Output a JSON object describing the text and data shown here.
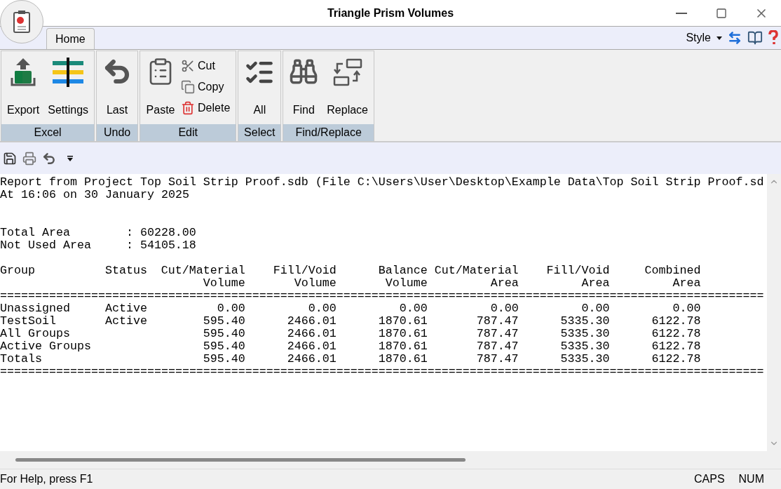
{
  "window": {
    "title": "Triangle Prism Volumes"
  },
  "tabs": [
    {
      "label": "Home",
      "selected": true
    }
  ],
  "style_menu": {
    "label": "Style"
  },
  "ribbon_groups": [
    {
      "label": "Excel",
      "items": [
        {
          "kind": "large",
          "label": "Export"
        },
        {
          "kind": "large",
          "label": "Settings"
        }
      ]
    },
    {
      "label": "Undo",
      "items": [
        {
          "kind": "large",
          "label": "Last"
        }
      ]
    },
    {
      "label": "Edit",
      "items": [
        {
          "kind": "large",
          "label": "Paste"
        },
        {
          "kind": "small",
          "label": "Cut"
        },
        {
          "kind": "small",
          "label": "Copy"
        },
        {
          "kind": "small",
          "label": "Delete"
        }
      ]
    },
    {
      "label": "Select",
      "items": [
        {
          "kind": "large",
          "label": "All"
        }
      ]
    },
    {
      "label": "Find/Replace",
      "items": [
        {
          "kind": "large",
          "label": "Find"
        },
        {
          "kind": "large",
          "label": "Replace"
        }
      ]
    }
  ],
  "report": {
    "header_lines": [
      "Report from Project Top Soil Strip Proof.sdb (File C:\\Users\\User\\Desktop\\Example Data\\Top Soil Strip Proof.sd",
      "At 16:06 on 30 January 2025"
    ],
    "summary": [
      {
        "label": "Total Area",
        "value": ": 60228.00"
      },
      {
        "label": "Not Used Area",
        "value": ": 54105.18"
      }
    ],
    "columns": [
      {
        "line1": "Group"
      },
      {
        "line1": "Status"
      },
      {
        "line1": "Cut/Material",
        "line2": "Volume"
      },
      {
        "line1": "Fill/Void",
        "line2": "Volume"
      },
      {
        "line1": "Balance",
        "line2": "Volume"
      },
      {
        "line1": "Cut/Material",
        "line2": "Area"
      },
      {
        "line1": "Fill/Void",
        "line2": "Area"
      },
      {
        "line1": "Combined",
        "line2": "Area"
      }
    ],
    "separator": "=============================================================================================================",
    "rows": [
      [
        "Unassigned",
        "Active",
        "0.00",
        "0.00",
        "0.00",
        "0.00",
        "0.00",
        "0.00"
      ],
      [
        "TestSoil",
        "Active",
        "595.40",
        "2466.01",
        "1870.61",
        "787.47",
        "5335.30",
        "6122.78"
      ],
      [
        "All Groups",
        "",
        "595.40",
        "2466.01",
        "1870.61",
        "787.47",
        "5335.30",
        "6122.78"
      ],
      [
        "Active Groups",
        "",
        "595.40",
        "2466.01",
        "1870.61",
        "787.47",
        "5335.30",
        "6122.78"
      ],
      [
        "Totals",
        "",
        "595.40",
        "2466.01",
        "1870.61",
        "787.47",
        "5335.30",
        "6122.78"
      ]
    ]
  },
  "status_bar": {
    "help": "For Help, press F1",
    "indicators": [
      "CAPS",
      "NUM"
    ]
  }
}
